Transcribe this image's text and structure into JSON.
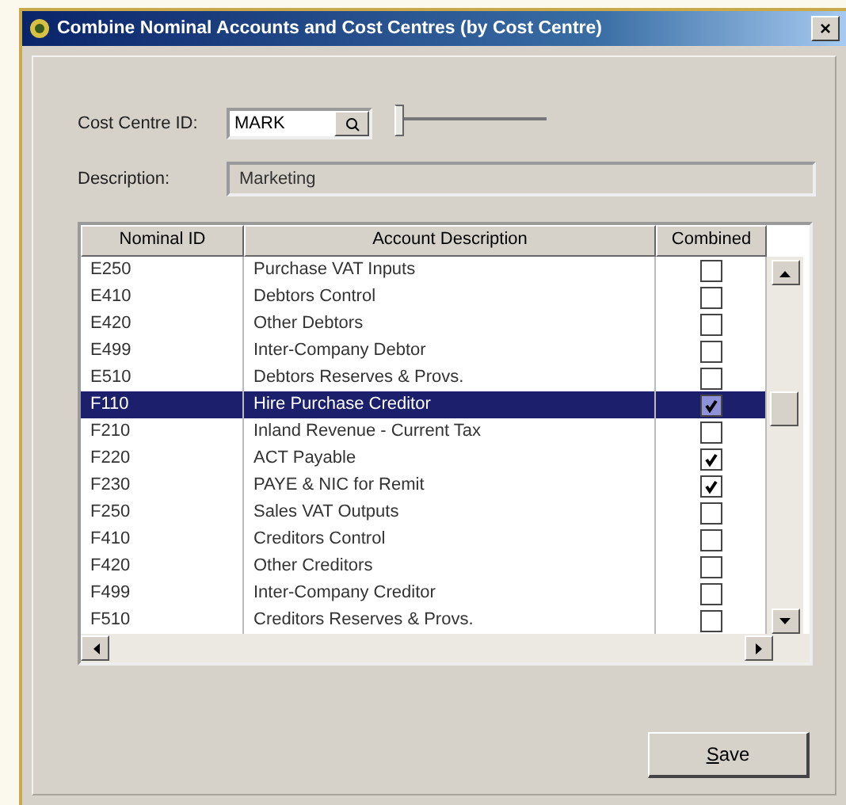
{
  "window": {
    "title": "Combine Nominal Accounts and Cost Centres (by Cost Centre)",
    "close": "×"
  },
  "cost_centre": {
    "label": "Cost Centre ID:",
    "value": "MARK",
    "slider": {
      "level": 0
    }
  },
  "description": {
    "label": "Description:",
    "value": "Marketing"
  },
  "table": {
    "columns": [
      "Nominal ID",
      "Account Description",
      "Combined"
    ],
    "rows": [
      {
        "id": "E250",
        "description": "Purchase VAT Inputs",
        "combined": false,
        "selected": false
      },
      {
        "id": "E410",
        "description": "Debtors Control",
        "combined": false,
        "selected": false
      },
      {
        "id": "E420",
        "description": "Other Debtors",
        "combined": false,
        "selected": false
      },
      {
        "id": "E499",
        "description": "Inter-Company Debtor",
        "combined": false,
        "selected": false
      },
      {
        "id": "E510",
        "description": "Debtors Reserves & Provs.",
        "combined": false,
        "selected": false
      },
      {
        "id": "F110",
        "description": "Hire Purchase Creditor",
        "combined": true,
        "selected": true
      },
      {
        "id": "F210",
        "description": "Inland Revenue - Current Tax",
        "combined": false,
        "selected": false
      },
      {
        "id": "F220",
        "description": "ACT Payable",
        "combined": true,
        "selected": false
      },
      {
        "id": "F230",
        "description": "PAYE & NIC for Remit",
        "combined": true,
        "selected": false
      },
      {
        "id": "F250",
        "description": "Sales VAT Outputs",
        "combined": false,
        "selected": false
      },
      {
        "id": "F410",
        "description": "Creditors Control",
        "combined": false,
        "selected": false
      },
      {
        "id": "F420",
        "description": "Other Creditors",
        "combined": false,
        "selected": false
      },
      {
        "id": "F499",
        "description": "Inter-Company Creditor",
        "combined": false,
        "selected": false
      },
      {
        "id": "F510",
        "description": "Creditors Reserves & Provs.",
        "combined": false,
        "selected": false
      }
    ]
  },
  "buttons": [
    "Save"
  ]
}
